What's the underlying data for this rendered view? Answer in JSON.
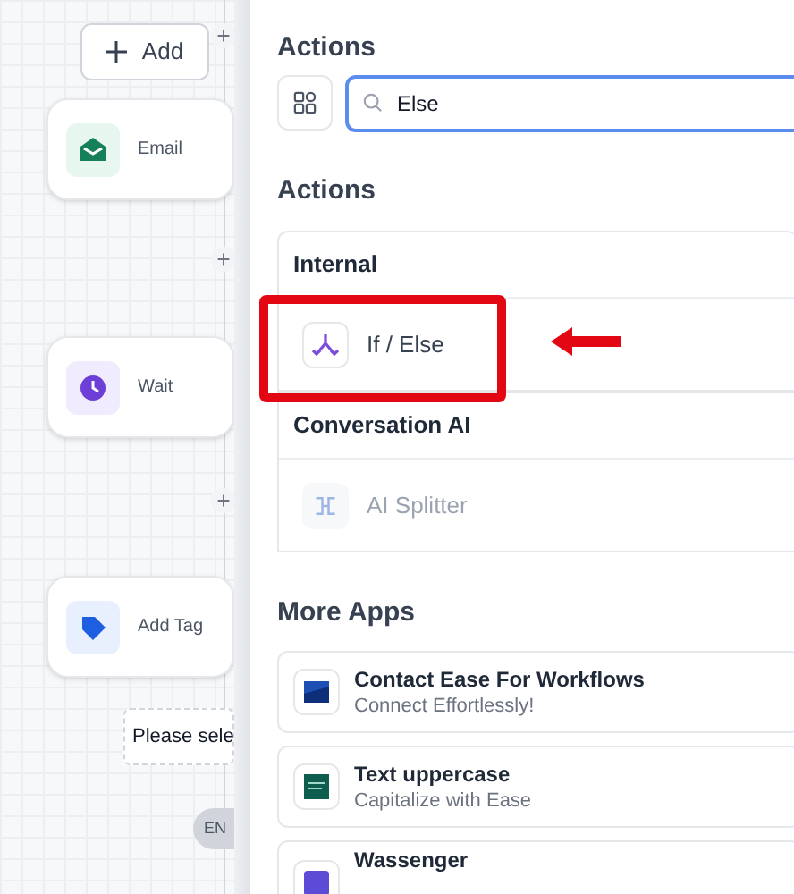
{
  "canvas": {
    "add_button": {
      "label": "Add"
    },
    "nodes": [
      {
        "label": "Email",
        "kind": "email"
      },
      {
        "label": "Wait",
        "kind": "wait"
      },
      {
        "label": "Add Tag",
        "kind": "tag"
      }
    ],
    "placeholder_node": {
      "label": "Please sele"
    },
    "end_pill": {
      "label": "EN"
    }
  },
  "panel": {
    "title": "Actions",
    "search": {
      "value": "Else"
    },
    "section_title": "Actions",
    "groups": [
      {
        "title": "Internal",
        "items": [
          {
            "label": "If / Else",
            "kind": "branch",
            "disabled": false,
            "highlighted": true
          }
        ]
      },
      {
        "title": "Conversation AI",
        "items": [
          {
            "label": "AI Splitter",
            "kind": "splitter",
            "disabled": true,
            "highlighted": false
          }
        ]
      }
    ],
    "more_apps": {
      "title": "More Apps",
      "apps": [
        {
          "name": "Contact Ease For Workflows",
          "tagline": "Connect Effortlessly!",
          "kind": "contact"
        },
        {
          "name": "Text uppercase",
          "tagline": "Capitalize with Ease",
          "kind": "text"
        },
        {
          "name": "Wassenger",
          "kind": "wassenger"
        }
      ]
    }
  }
}
